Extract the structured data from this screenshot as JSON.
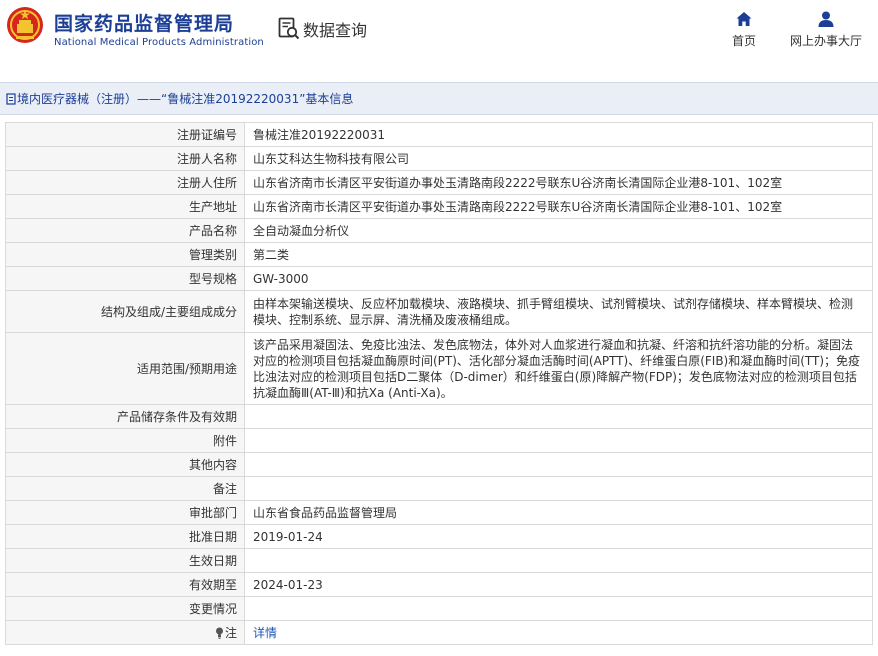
{
  "header": {
    "site_name_cn": "国家药品监督管理局",
    "site_name_en": "National Medical Products Administration",
    "data_query_label": "数据查询",
    "nav": [
      {
        "label": "首页",
        "icon": "home-icon"
      },
      {
        "label": "网上办事大厅",
        "icon": "user-icon"
      }
    ]
  },
  "breadcrumb": {
    "text": "境内医疗器械（注册）——“鲁械注准20192220031”基本信息"
  },
  "detail": {
    "rows": [
      {
        "label": "注册证编号",
        "value": "鲁械注准20192220031"
      },
      {
        "label": "注册人名称",
        "value": "山东艾科达生物科技有限公司"
      },
      {
        "label": "注册人住所",
        "value": "山东省济南市长清区平安街道办事处玉清路南段2222号联东U谷济南长清国际企业港8-101、102室"
      },
      {
        "label": "生产地址",
        "value": "山东省济南市长清区平安街道办事处玉清路南段2222号联东U谷济南长清国际企业港8-101、102室"
      },
      {
        "label": "产品名称",
        "value": "全自动凝血分析仪"
      },
      {
        "label": "管理类别",
        "value": "第二类"
      },
      {
        "label": "型号规格",
        "value": "GW-3000"
      },
      {
        "label": "结构及组成/主要组成成分",
        "value": "由样本架输送模块、反应杯加载模块、液路模块、抓手臂组模块、试剂臂模块、试剂存储模块、样本臂模块、检测模块、控制系统、显示屏、清洗桶及废液桶组成。"
      },
      {
        "label": "适用范围/预期用途",
        "value": "该产品采用凝固法、免疫比浊法、发色底物法，体外对人血浆进行凝血和抗凝、纤溶和抗纤溶功能的分析。凝固法对应的检测项目包括凝血酶原时间(PT)、活化部分凝血活酶时间(APTT)、纤维蛋白原(FIB)和凝血酶时间(TT)；免疫比浊法对应的检测项目包括D二聚体（D-dimer）和纤维蛋白(原)降解产物(FDP)；发色底物法对应的检测项目包括抗凝血酶Ⅲ(AT-Ⅲ)和抗Xa (Anti-Xa)。"
      },
      {
        "label": "产品储存条件及有效期",
        "value": ""
      },
      {
        "label": "附件",
        "value": ""
      },
      {
        "label": "其他内容",
        "value": ""
      },
      {
        "label": "备注",
        "value": ""
      },
      {
        "label": "审批部门",
        "value": "山东省食品药品监督管理局"
      },
      {
        "label": "批准日期",
        "value": "2019-01-24"
      },
      {
        "label": "生效日期",
        "value": ""
      },
      {
        "label": "有效期至",
        "value": "2024-01-23"
      },
      {
        "label": "变更情况",
        "value": ""
      },
      {
        "label": "注",
        "value": "详情"
      }
    ]
  },
  "colors": {
    "brand_blue": "#1c3f95",
    "emblem_red": "#d7261e",
    "emblem_gold": "#f4c430",
    "crumb_bg": "#e9eef7",
    "link_blue": "#1c57b5"
  }
}
